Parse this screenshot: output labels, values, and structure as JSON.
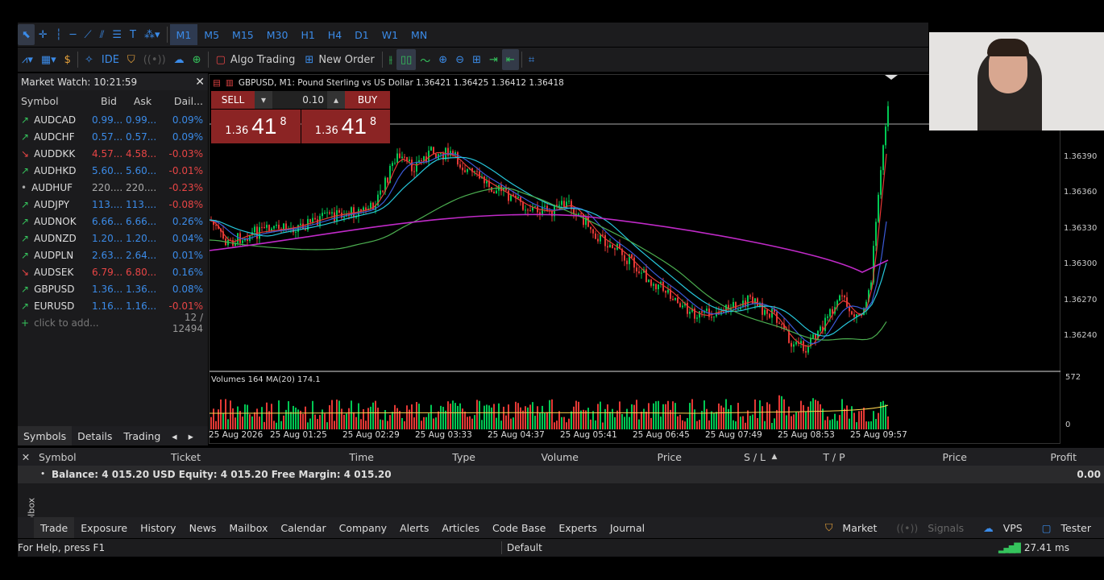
{
  "toolbar1": {
    "timeframes": [
      "M1",
      "M5",
      "M15",
      "M30",
      "H1",
      "H4",
      "D1",
      "W1",
      "MN"
    ],
    "active_timeframe": "M1"
  },
  "toolbar2": {
    "ide_label": "IDE",
    "algo_trading_label": "Algo Trading",
    "new_order_label": "New Order"
  },
  "market_watch": {
    "title": "Market Watch: 10:21:59",
    "columns": [
      "Symbol",
      "Bid",
      "Ask",
      "Dail..."
    ],
    "rows": [
      {
        "dir": "up",
        "symbol": "AUDCAD",
        "bid": "0.99...",
        "ask": "0.99...",
        "daily": "0.09%"
      },
      {
        "dir": "up",
        "symbol": "AUDCHF",
        "bid": "0.57...",
        "ask": "0.57...",
        "daily": "0.09%"
      },
      {
        "dir": "down",
        "symbol": "AUDDKK",
        "bid": "4.57...",
        "ask": "4.58...",
        "daily": "-0.03%"
      },
      {
        "dir": "up",
        "symbol": "AUDHKD",
        "bid": "5.60...",
        "ask": "5.60...",
        "daily": "-0.01%"
      },
      {
        "dir": "neutral",
        "symbol": "AUDHUF",
        "bid": "220....",
        "ask": "220....",
        "daily": "-0.23%"
      },
      {
        "dir": "up",
        "symbol": "AUDJPY",
        "bid": "113....",
        "ask": "113....",
        "daily": "-0.08%"
      },
      {
        "dir": "up",
        "symbol": "AUDNOK",
        "bid": "6.66...",
        "ask": "6.66...",
        "daily": "0.26%"
      },
      {
        "dir": "up",
        "symbol": "AUDNZD",
        "bid": "1.20...",
        "ask": "1.20...",
        "daily": "0.04%"
      },
      {
        "dir": "up",
        "symbol": "AUDPLN",
        "bid": "2.63...",
        "ask": "2.64...",
        "daily": "0.01%"
      },
      {
        "dir": "down",
        "symbol": "AUDSEK",
        "bid": "6.79...",
        "ask": "6.80...",
        "daily": "0.16%"
      },
      {
        "dir": "up",
        "symbol": "GBPUSD",
        "bid": "1.36...",
        "ask": "1.36...",
        "daily": "0.08%"
      },
      {
        "dir": "up",
        "symbol": "EURUSD",
        "bid": "1.16...",
        "ask": "1.16...",
        "daily": "-0.01%"
      }
    ],
    "add_placeholder": "click to add...",
    "count": "12 / 12494",
    "tabs": [
      "Symbols",
      "Details",
      "Trading"
    ]
  },
  "chart": {
    "title": "GBPUSD, M1:  Pound Sterling vs US Dollar  1.36421  1.36425  1.36412  1.36418",
    "sell_label": "SELL",
    "buy_label": "BUY",
    "lot": "0.10",
    "sell_price_small": "1.36",
    "sell_price_big": "41",
    "sell_price_sup": "8",
    "buy_price_small": "1.36",
    "buy_price_big": "41",
    "buy_price_sup": "8",
    "volumes_label": "Volumes 164 MA(20) 174.1",
    "price_ticks": [
      "1.36390",
      "1.36360",
      "1.36330",
      "1.36300",
      "1.36270",
      "1.36240"
    ],
    "volume_ticks": [
      "572",
      "0"
    ],
    "time_ticks": [
      "25 Aug 2026",
      "25 Aug 01:25",
      "25 Aug 02:29",
      "25 Aug 03:33",
      "25 Aug 04:37",
      "25 Aug 05:41",
      "25 Aug 06:45",
      "25 Aug 07:49",
      "25 Aug 08:53",
      "25 Aug 09:57"
    ]
  },
  "toolbox": {
    "columns": [
      "Symbol",
      "Ticket",
      "Time",
      "Type",
      "Volume",
      "Price",
      "S / L",
      "T / P",
      "Price",
      "Profit"
    ],
    "balance_line": "Balance: 4 015.20 USD  Equity: 4 015.20  Free Margin: 4 015.20",
    "profit": "0.00",
    "side_label": "Toolbox",
    "tabs": [
      "Trade",
      "Exposure",
      "History",
      "News",
      "Mailbox",
      "Calendar",
      "Company",
      "Alerts",
      "Articles",
      "Code Base",
      "Experts",
      "Journal"
    ],
    "right_tabs": [
      "Market",
      "Signals",
      "VPS",
      "Tester"
    ]
  },
  "status": {
    "help": "For Help, press F1",
    "profile": "Default",
    "ping": "27.41 ms"
  },
  "colors": {
    "bull": "#00c853",
    "bear": "#e53935",
    "sell_bg": "#8b2424",
    "accent": "#3b8be8"
  }
}
